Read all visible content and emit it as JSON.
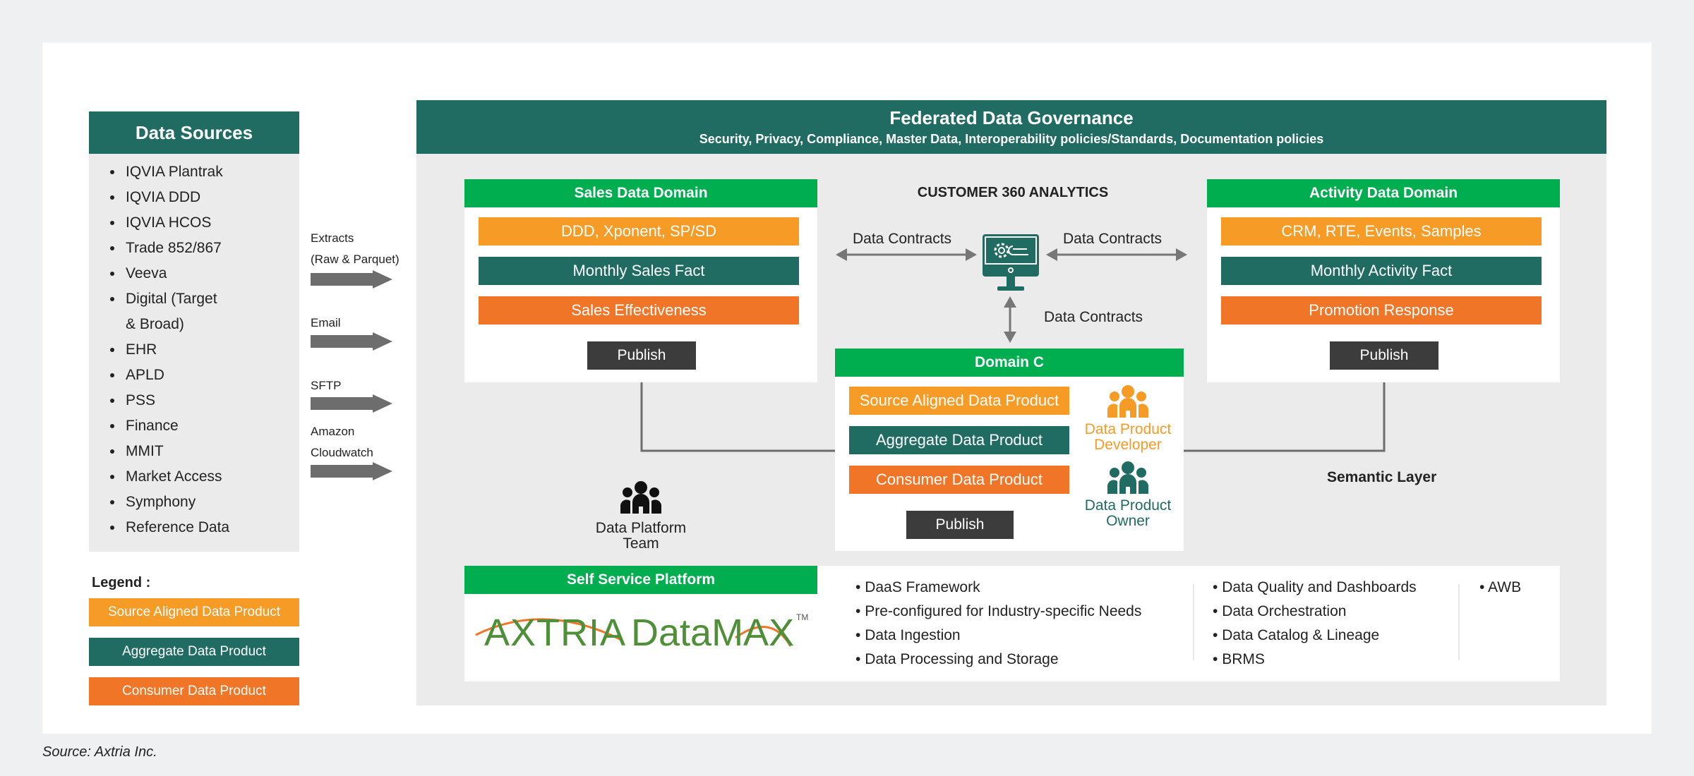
{
  "data_sources": {
    "title": "Data Sources",
    "items": [
      "IQVIA Plantrak",
      "IQVIA DDD",
      "IQVIA HCOS",
      "Trade 852/867",
      "Veeva",
      "Digital (Target",
      "& Broad)",
      "EHR",
      "APLD",
      "PSS",
      "Finance",
      "MMIT",
      "Market Access",
      "Symphony",
      "Reference Data"
    ]
  },
  "ingestion": {
    "channels": [
      {
        "label_lines": [
          "Extracts",
          "(Raw & Parquet)"
        ],
        "icon": "right-arrow-icon"
      },
      {
        "label_lines": [
          "Email"
        ],
        "icon": "right-arrow-icon"
      },
      {
        "label_lines": [
          "SFTP"
        ],
        "icon": "right-arrow-icon"
      },
      {
        "label_lines": [
          "Amazon",
          "Cloudwatch"
        ],
        "icon": "right-arrow-icon"
      }
    ]
  },
  "governance": {
    "title": "Federated Data Governance",
    "subtitle": "Security, Privacy, Compliance, Master Data, Interoperability policies/Standards, Documentation policies"
  },
  "sales_domain": {
    "title": "Sales Data Domain",
    "products": [
      "DDD, Xponent, SP/SD",
      "Monthly Sales Fact",
      "Sales Effectiveness"
    ],
    "publish_label": "Publish"
  },
  "activity_domain": {
    "title": "Activity Data Domain",
    "products": [
      "CRM, RTE, Events, Samples",
      "Monthly Activity Fact",
      "Promotion Response"
    ],
    "publish_label": "Publish"
  },
  "analytics": {
    "title": "CUSTOMER 360 ANALYTICS",
    "icon": "monitor-settings-icon",
    "contracts_left": "Data Contracts",
    "contracts_right": "Data Contracts",
    "contracts_down": "Data Contracts"
  },
  "domain_c": {
    "title": "Domain C",
    "products": [
      "Source Aligned Data Product",
      "Aggregate Data Product",
      "Consumer Data Product"
    ],
    "publish_label": "Publish",
    "developer_label_lines": [
      "Data Product",
      "Developer"
    ],
    "owner_label_lines": [
      "Data Product",
      "Owner"
    ]
  },
  "platform_team": {
    "label_lines": [
      "Data Platform",
      "Team"
    ],
    "icon": "team-icon"
  },
  "semantic_layer": "Semantic Layer",
  "self_service": {
    "title": "Self Service Platform",
    "logo_text_left": "AXTRIA",
    "logo_text_right": "DataMAX",
    "logo_tm": "TM",
    "col1": [
      "DaaS Framework",
      "Pre-configured for Industry-specific Needs",
      "Data Ingestion",
      "Data Processing and Storage"
    ],
    "col2": [
      "Data Quality and Dashboards",
      "Data Orchestration",
      "Data Catalog & Lineage",
      "BRMS"
    ],
    "col3": [
      "AWB"
    ]
  },
  "legend": {
    "title": "Legend :",
    "items": [
      "Source Aligned Data Product",
      "Aggregate Data Product",
      "Consumer Data Product"
    ]
  },
  "colors": {
    "teal": "#206c62",
    "green": "#00ae4f",
    "source_aligned": "#f59b26",
    "consumer": "#f07526",
    "publish": "#3c3c3c"
  },
  "source_note": {
    "prefix": "Source: ",
    "name": "Axtria Inc."
  }
}
